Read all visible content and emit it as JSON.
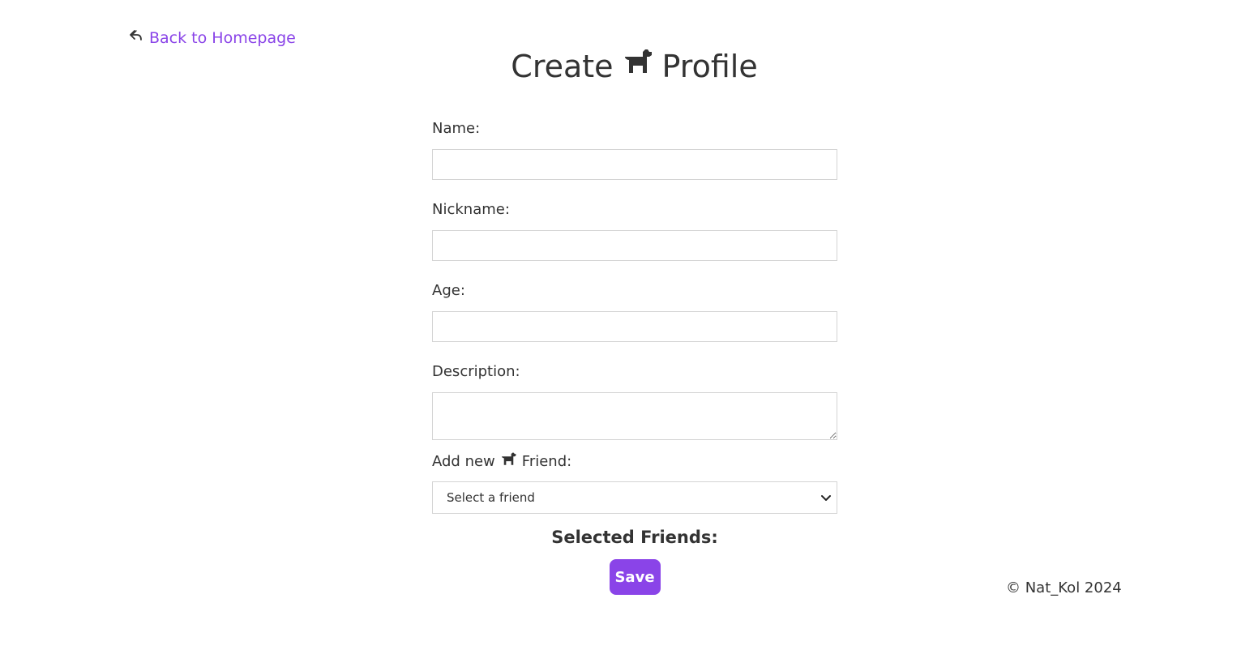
{
  "nav": {
    "back_label": "Back to Homepage",
    "back_icon": "reply-arrow-icon"
  },
  "header": {
    "title_prefix": "Create",
    "title_suffix": "Profile",
    "title_icon": "dog-icon"
  },
  "form": {
    "name_label": "Name:",
    "name_value": "",
    "nickname_label": "Nickname:",
    "nickname_value": "",
    "age_label": "Age:",
    "age_value": "",
    "description_label": "Description:",
    "description_value": "",
    "friend_label_prefix": "Add new",
    "friend_label_suffix": "Friend:",
    "friend_select_value": "Select a friend",
    "selected_friends_heading": "Selected Friends:",
    "save_label": "Save"
  },
  "footer": {
    "copyright": "© Nat_Kol 2024"
  },
  "colors": {
    "accent": "#8a44e8",
    "text": "#333333",
    "border": "#d4d4d4"
  }
}
